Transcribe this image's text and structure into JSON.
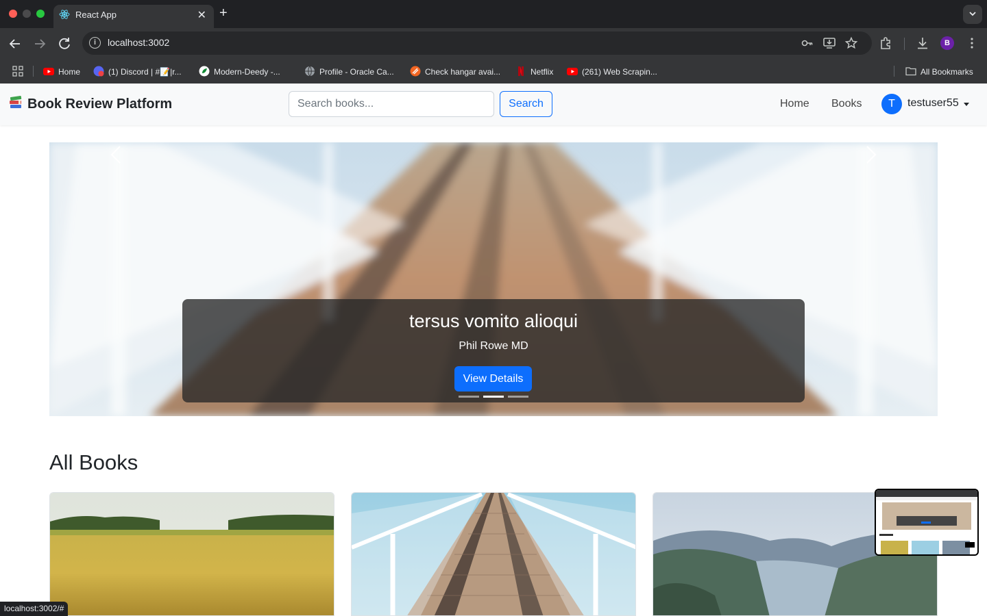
{
  "browser": {
    "tab_title": "React App",
    "tab_close": "✕",
    "new_tab": "+",
    "url": "localhost:3002",
    "profile_initial": "B",
    "bookmarks": [
      {
        "label": "Home",
        "icon": "youtube-icon"
      },
      {
        "label": "(1) Discord | #📝|r...",
        "icon": "discord-icon"
      },
      {
        "label": "Modern-Deedy -...",
        "icon": "overleaf-icon"
      },
      {
        "label": "Profile - Oracle Ca...",
        "icon": "globe-icon"
      },
      {
        "label": "Check hangar avai...",
        "icon": "hangar-icon"
      },
      {
        "label": "Netflix",
        "icon": "netflix-icon"
      },
      {
        "label": "(261) Web Scrapin...",
        "icon": "youtube-icon"
      }
    ],
    "all_bookmarks": "All Bookmarks",
    "status_url": "localhost:3002/#"
  },
  "navbar": {
    "brand": "Book Review Platform",
    "search_placeholder": "Search books...",
    "search_button": "Search",
    "links": [
      "Home",
      "Books"
    ],
    "user_initial": "T",
    "username": "testuser55"
  },
  "carousel": {
    "title": "tersus vomito alioqui",
    "author": "Phil Rowe MD",
    "button": "View Details",
    "active_index": 1,
    "slide_count": 3
  },
  "books_section": {
    "title": "All Books"
  },
  "colors": {
    "primary": "#0d6efd",
    "navbar_bg": "#f8f9fa",
    "chrome_dark": "#202124",
    "chrome_toolbar": "#353638"
  }
}
